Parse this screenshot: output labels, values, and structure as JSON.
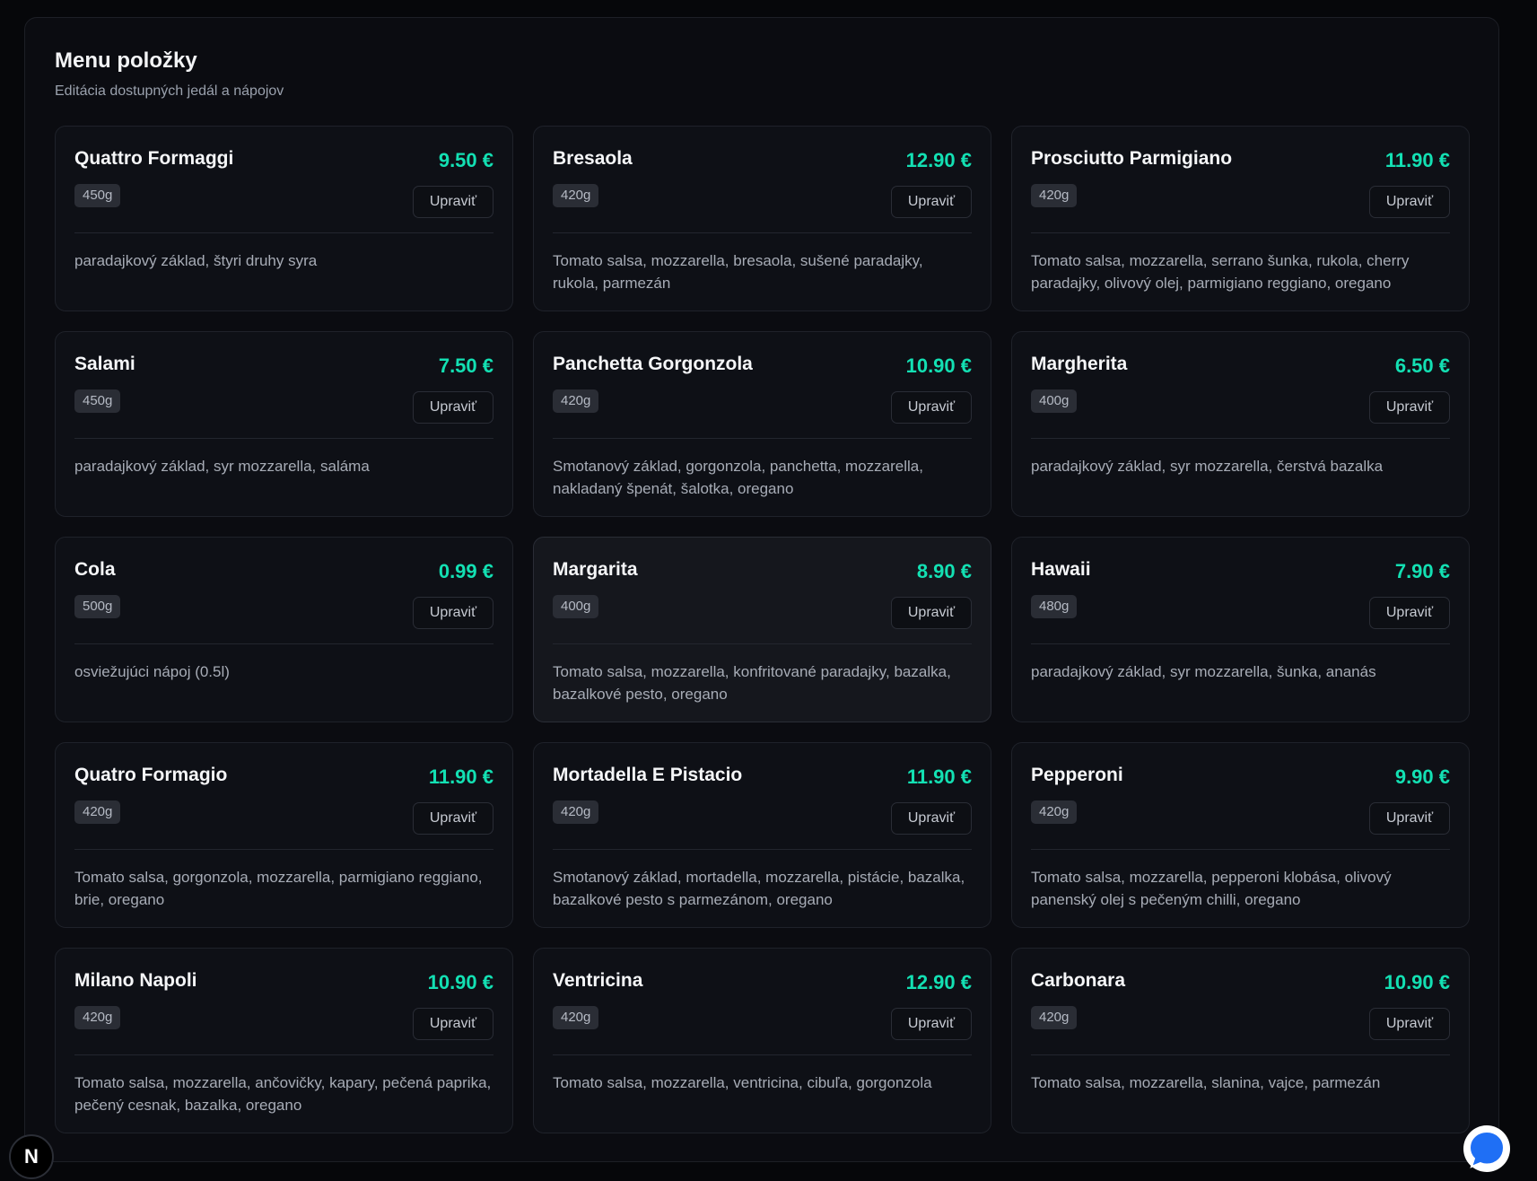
{
  "header": {
    "title": "Menu položky",
    "subtitle": "Editácia dostupných jedál a nápojov"
  },
  "items": [
    {
      "name": "Quattro Formaggi",
      "price": "9.50 €",
      "weight": "450g",
      "edit_label": "Upraviť",
      "description": "paradajkový základ, štyri druhy syra"
    },
    {
      "name": "Bresaola",
      "price": "12.90 €",
      "weight": "420g",
      "edit_label": "Upraviť",
      "description": "Tomato salsa, mozzarella, bresaola, sušené paradajky, rukola, parmezán"
    },
    {
      "name": "Prosciutto Parmigiano",
      "price": "11.90 €",
      "weight": "420g",
      "edit_label": "Upraviť",
      "description": "Tomato salsa, mozzarella, serrano šunka, rukola, cherry paradajky, olivový olej, parmigiano reggiano, oregano"
    },
    {
      "name": "Salami",
      "price": "7.50 €",
      "weight": "450g",
      "edit_label": "Upraviť",
      "description": "paradajkový základ, syr mozzarella, saláma"
    },
    {
      "name": "Panchetta Gorgonzola",
      "price": "10.90 €",
      "weight": "420g",
      "edit_label": "Upraviť",
      "description": "Smotanový základ, gorgonzola, panchetta, mozzarella, nakladaný špenát, šalotka, oregano"
    },
    {
      "name": "Margherita",
      "price": "6.50 €",
      "weight": "400g",
      "edit_label": "Upraviť",
      "description": "paradajkový základ, syr mozzarella, čerstvá bazalka"
    },
    {
      "name": "Cola",
      "price": "0.99 €",
      "weight": "500g",
      "edit_label": "Upraviť",
      "description": "osviežujúci nápoj (0.5l)"
    },
    {
      "name": "Margarita",
      "price": "8.90 €",
      "weight": "400g",
      "edit_label": "Upraviť",
      "description": "Tomato salsa, mozzarella, konfritované paradajky, bazalka, bazalkové pesto, oregano"
    },
    {
      "name": "Hawaii",
      "price": "7.90 €",
      "weight": "480g",
      "edit_label": "Upraviť",
      "description": "paradajkový základ, syr mozzarella, šunka, ananás"
    },
    {
      "name": "Quatro Formagio",
      "price": "11.90 €",
      "weight": "420g",
      "edit_label": "Upraviť",
      "description": "Tomato salsa, gorgonzola, mozzarella, parmigiano reggiano, brie, oregano"
    },
    {
      "name": "Mortadella E Pistacio",
      "price": "11.90 €",
      "weight": "420g",
      "edit_label": "Upraviť",
      "description": "Smotanový základ, mortadella, mozzarella, pistácie, bazalka, bazalkové pesto s parmezánom, oregano"
    },
    {
      "name": "Pepperoni",
      "price": "9.90 €",
      "weight": "420g",
      "edit_label": "Upraviť",
      "description": "Tomato salsa, mozzarella, pepperoni klobása, olivový panenský olej s pečeným chilli, oregano"
    },
    {
      "name": "Milano Napoli",
      "price": "10.90 €",
      "weight": "420g",
      "edit_label": "Upraviť",
      "description": "Tomato salsa, mozzarella, ančovičky, kapary, pečená paprika, pečený cesnak, bazalka, oregano"
    },
    {
      "name": "Ventricina",
      "price": "12.90 €",
      "weight": "420g",
      "edit_label": "Upraviť",
      "description": "Tomato salsa, mozzarella, ventricina, cibuľa, gorgonzola"
    },
    {
      "name": "Carbonara",
      "price": "10.90 €",
      "weight": "420g",
      "edit_label": "Upraviť",
      "description": "Tomato salsa, mozzarella, slanina, vajce, parmezán"
    }
  ],
  "highlighted_item": "Margarita",
  "floating": {
    "dev_badge_letter": "N",
    "dev_badge_icon": "nextjs-icon",
    "chat_icon": "chat-bubble-icon"
  },
  "colors": {
    "background": "#06070a",
    "panel": "#0b0c11",
    "card": "#0e1016",
    "price_accent": "#13e0b3",
    "chat_accent": "#1f6ff5"
  }
}
